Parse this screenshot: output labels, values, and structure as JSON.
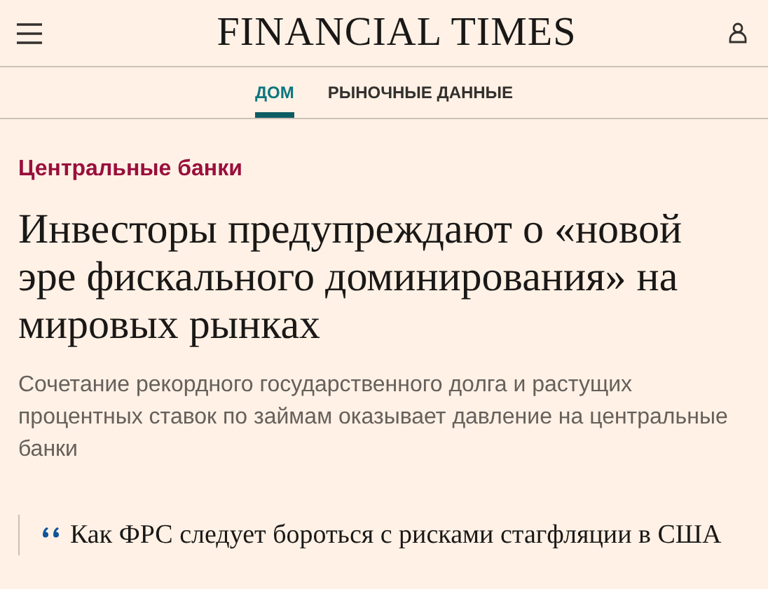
{
  "header": {
    "logo": "FINANCIAL TIMES"
  },
  "nav": {
    "tabs": [
      {
        "label": "ДОМ",
        "selected": true
      },
      {
        "label": "РЫНОЧНЫЕ ДАННЫЕ",
        "selected": false
      }
    ]
  },
  "article": {
    "topic": "Центральные банки",
    "headline": "Инвесторы предупреждают о «новой эре фискального доминирования» на мировых рынках",
    "standfirst": "Сочетание рекордного государственного долга и растущих процентных ставок по займам оказывает давление на центральные банки"
  },
  "related": {
    "title": "Как ФРС следует бороться с рисками стагфляции в США"
  }
}
